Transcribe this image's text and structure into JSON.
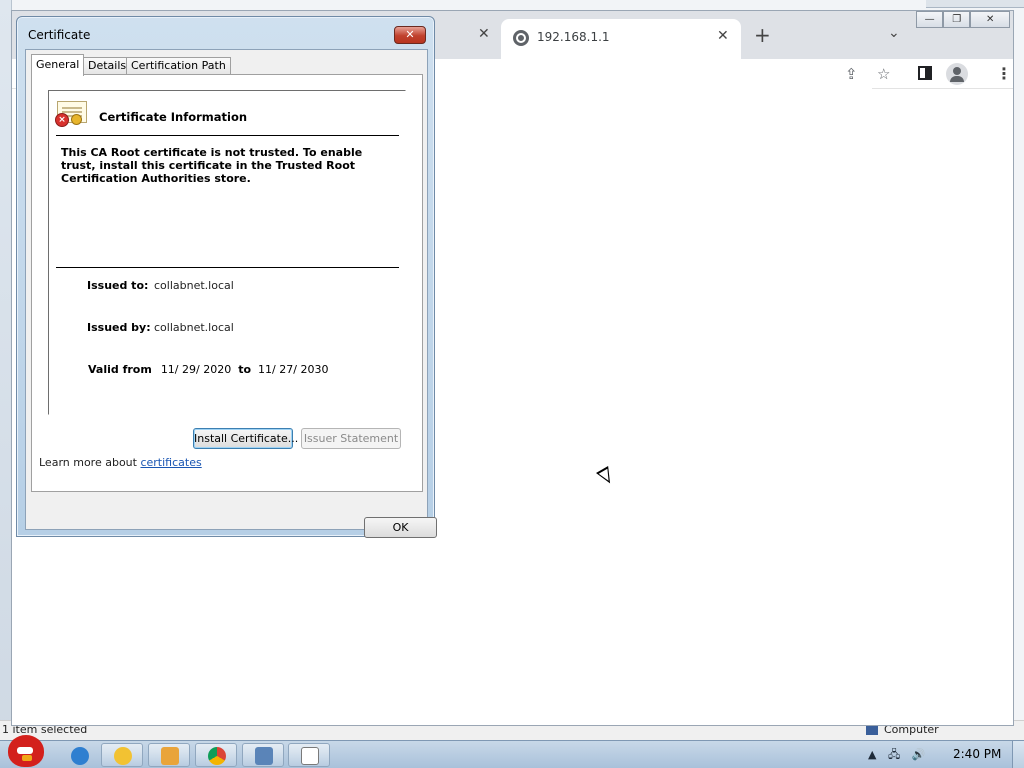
{
  "explorer": {
    "status_left": "1 item selected",
    "status_right": "Computer"
  },
  "browser": {
    "inactive_tab_close": "✕",
    "active_tab": {
      "title": "192.168.1.1",
      "close": "✕"
    },
    "new_tab": "+",
    "tab_search": "⌄",
    "window_buttons": {
      "minimize": "—",
      "restore": "❐",
      "close": "✕"
    },
    "toolbar_icons": {
      "share": "⇪",
      "star": "☆",
      "menu": "⋮"
    }
  },
  "dialog": {
    "title": "Certificate",
    "close_label": "✕",
    "tabs": [
      "General",
      "Details",
      "Certification Path"
    ],
    "info_title": "Certificate Information",
    "warning": "This CA Root certificate is not trusted. To enable trust, install this certificate in the Trusted Root Certification Authorities store.",
    "issued_to_label": "Issued to:",
    "issued_to": "collabnet.local",
    "issued_by_label": "Issued by:",
    "issued_by": "collabnet.local",
    "valid_from_label": "Valid from",
    "valid_from": "11/ 29/ 2020",
    "valid_to_label": "to",
    "valid_to": "11/ 27/ 2030",
    "install_button": "Install Certificate...",
    "issuer_button": "Issuer Statement",
    "learn_more_prefix": "Learn more about ",
    "learn_more_link": "certificates",
    "ok_button": "OK"
  },
  "taskbar": {
    "clock": "2:40 PM",
    "tray_icons": [
      "▲",
      "🖧",
      "🔊"
    ]
  }
}
